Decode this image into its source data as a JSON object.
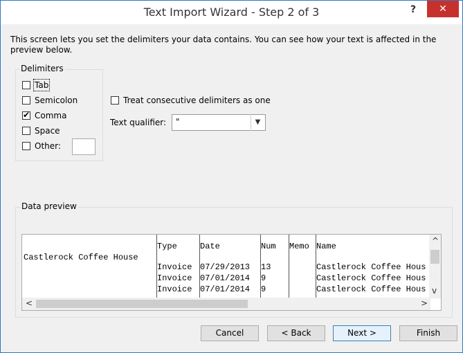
{
  "window": {
    "title": "Text Import Wizard - Step 2 of 3",
    "help_glyph": "?",
    "close_glyph": "✕"
  },
  "description": "This screen lets you set the delimiters your data contains.  You can see how your text is affected in the preview below.",
  "delimiters": {
    "legend": "Delimiters",
    "options": [
      {
        "label": "Tab",
        "checked": false
      },
      {
        "label": "Semicolon",
        "checked": false
      },
      {
        "label": "Comma",
        "checked": true
      },
      {
        "label": "Space",
        "checked": false
      },
      {
        "label": "Other:",
        "checked": false
      }
    ],
    "other_value": ""
  },
  "consecutive": {
    "label": "Treat consecutive delimiters as one",
    "checked": false
  },
  "qualifier": {
    "label": "Text qualifier:",
    "value": "\""
  },
  "preview": {
    "legend": "Data preview",
    "columns": [
      {
        "rows": [
          "",
          "Castlerock Coffee House",
          "",
          "",
          ""
        ]
      },
      {
        "rows": [
          "Type",
          "",
          "Invoice",
          "Invoice",
          "Invoice"
        ]
      },
      {
        "rows": [
          "Date",
          "",
          "07/29/2013",
          "07/01/2014",
          "07/01/2014"
        ]
      },
      {
        "rows": [
          "Num",
          "",
          "13",
          "9",
          "9"
        ]
      },
      {
        "rows": [
          "Memo",
          "",
          "",
          "",
          ""
        ]
      },
      {
        "rows": [
          "Name",
          "",
          "Castlerock Coffee Hous",
          "Castlerock Coffee Hous",
          "Castlerock Coffee Hous"
        ]
      }
    ]
  },
  "buttons": {
    "cancel": "Cancel",
    "back": "< Back",
    "next": "Next >",
    "finish": "Finish"
  },
  "scroll_glyphs": {
    "up": "^",
    "down": "v",
    "left": "<",
    "right": ">"
  }
}
